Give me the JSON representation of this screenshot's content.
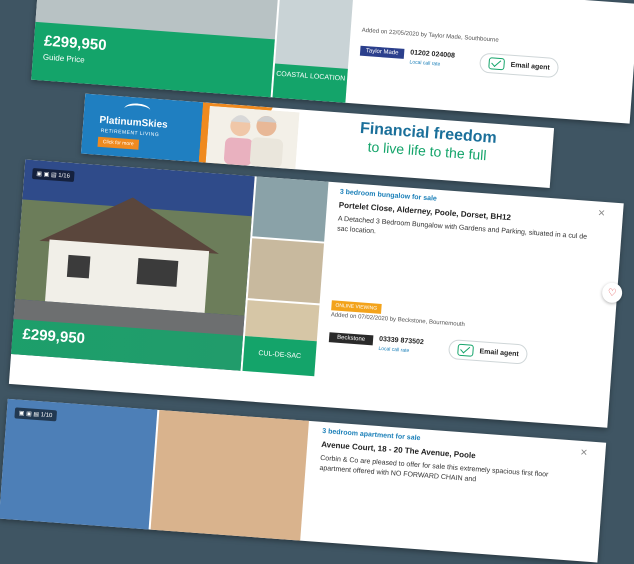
{
  "listing1": {
    "price": "£299,950",
    "price_qualifier": "Guide Price",
    "tag": "COASTAL LOCATION",
    "added": "Added on 22/05/2020 by Taylor Made, Southbourne",
    "agent_logo": "Taylor Made",
    "phone": "01202 024008",
    "local_call_rate": "Local call rate",
    "email_agent": "Email agent"
  },
  "banner": {
    "brand": "PlatinumSkies",
    "brand_sub": "RETIREMENT LIVING",
    "cta": "Click for more",
    "headline1": "Financial freedom",
    "headline2": "to live life to the full"
  },
  "listing2": {
    "media_count": "1/16",
    "price": "£299,950",
    "tag": "CUL-DE-SAC",
    "subtitle": "3 bedroom bungalow for sale",
    "address": "Portelet Close, Alderney, Poole, Dorset, BH12",
    "description": "A Detached 3 Bedroom Bungalow with Gardens and Parking, situated in a cul de sac location.",
    "badge": "ONLINE VIEWING",
    "added": "Added on 07/02/2020 by Beckstone, Bournemouth",
    "agent_logo": "Beckstone",
    "phone": "03339 873502",
    "local_call_rate": "Local call rate",
    "email_agent": "Email agent",
    "close": "×"
  },
  "listing3": {
    "media_count": "1/10",
    "subtitle": "3 bedroom apartment for sale",
    "address": "Avenue Court, 18 - 20 The Avenue, Poole",
    "description": "Corbin & Co are pleased to offer for sale this extremely spacious first floor apartment offered with NO FORWARD CHAIN and",
    "close": "×"
  }
}
